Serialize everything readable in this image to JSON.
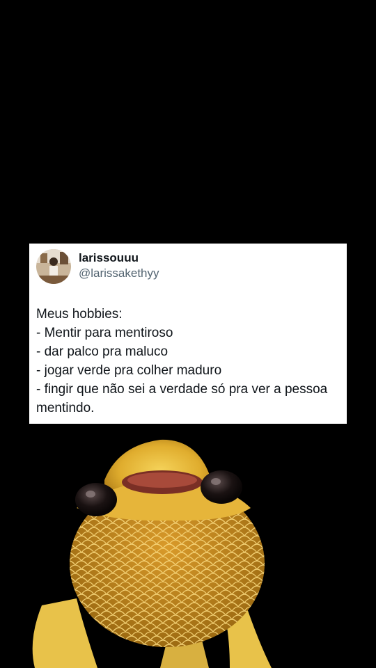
{
  "tweet": {
    "display_name": "larissouuu",
    "handle": "@larissakethyy",
    "lines": [
      "Meus hobbies:",
      "- Mentir para mentiroso",
      "- dar palco pra maluco",
      "- jogar verde pra colher maduro",
      "- fingir que não sei a verdade só pra ver a pessoa",
      "mentindo."
    ]
  },
  "colors": {
    "background": "#000000",
    "card": "#ffffff",
    "name_text": "#0f1419",
    "handle_text": "#536471",
    "fish_body": "#e8b93a"
  },
  "icons": {
    "avatar": "profile-photo",
    "sticker": "golden-fish-face"
  }
}
